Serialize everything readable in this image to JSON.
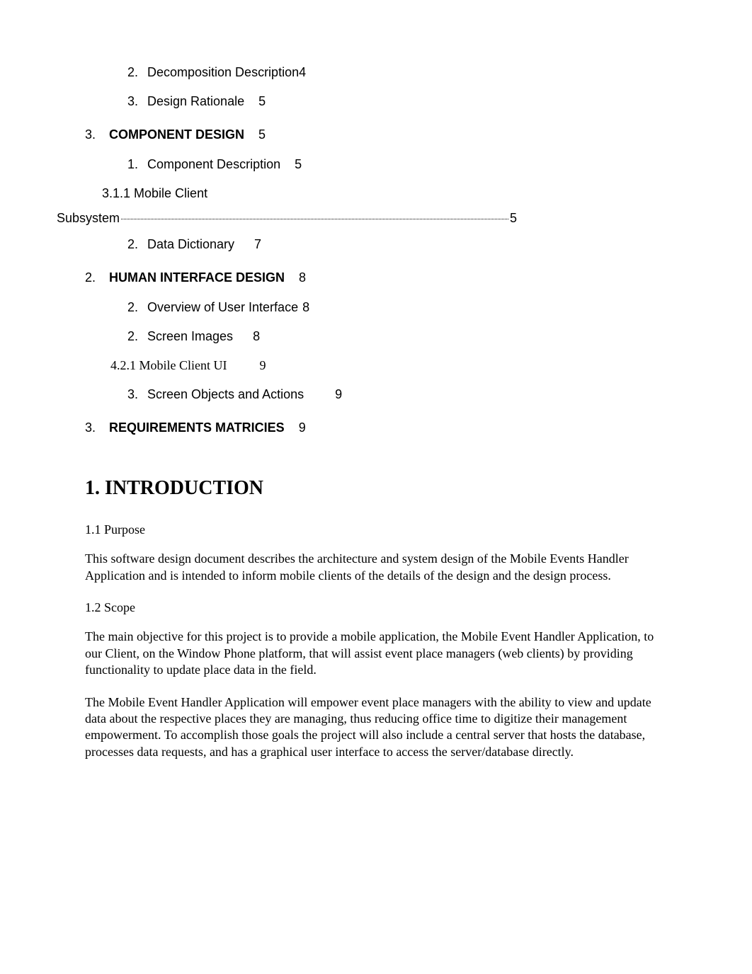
{
  "toc": {
    "items": [
      {
        "num": "2.",
        "label": "Decomposition Description",
        "page": "4",
        "indent": "1",
        "bold": false,
        "serif": false,
        "pagePad": "tight"
      },
      {
        "num": "3.",
        "label": "Design Rationale",
        "page": "5",
        "indent": "1",
        "bold": false,
        "serif": false,
        "pagePad": "norm"
      },
      {
        "num": "3.",
        "label": "COMPONENT DESIGN",
        "page": "5",
        "indent": "0",
        "bold": true,
        "serif": false,
        "pagePad": "norm"
      },
      {
        "num": "1.",
        "label": "Component Description",
        "page": "5",
        "indent": "1",
        "bold": false,
        "serif": false,
        "pagePad": "norm"
      }
    ],
    "dotted": {
      "line1": "3.1.1 Mobile Client",
      "line2_label": "Subsystem",
      "page": "5"
    },
    "items2": [
      {
        "num": "2.",
        "label": "Data Dictionary",
        "page": "7",
        "indent": "1",
        "bold": false,
        "serif": false,
        "pagePad": "wide"
      },
      {
        "num": "2.",
        "label": "HUMAN INTERFACE DESIGN",
        "page": "8",
        "indent": "0",
        "bold": true,
        "serif": false,
        "pagePad": "norm"
      },
      {
        "num": "2.",
        "label": "Overview of User Interface",
        "page": "8",
        "indent": "1",
        "bold": false,
        "serif": false,
        "pagePad": "tight2"
      },
      {
        "num": "2.",
        "label": "Screen Images",
        "page": "8",
        "indent": "1",
        "bold": false,
        "serif": false,
        "pagePad": "wide"
      },
      {
        "num": "",
        "label": "4.2.1 Mobile Client UI",
        "page": "9",
        "indent": "3",
        "bold": false,
        "serif": true,
        "pagePad": "wide2"
      },
      {
        "num": "3.",
        "label": "Screen Objects and Actions",
        "page": "9",
        "indent": "1",
        "bold": false,
        "serif": false,
        "pagePad": "vwide"
      },
      {
        "num": "3.",
        "label": "REQUIREMENTS MATRICIES",
        "page": "9",
        "indent": "0",
        "bold": true,
        "serif": false,
        "pagePad": "norm"
      }
    ]
  },
  "body": {
    "h1": "1. INTRODUCTION",
    "sec1": {
      "head": "1.1 Purpose",
      "para": "This software design document describes the architecture and system design of the Mobile Events Handler Application and is intended to inform mobile clients of the details of the design and the design process."
    },
    "sec2": {
      "head": "1.2 Scope",
      "para1": "The main objective for this project is to provide a mobile application, the Mobile Event Handler Application, to our Client, on the Window Phone platform, that will assist event place managers (web clients) by providing functionality to update place data in the field.",
      "para2": "The Mobile Event Handler Application will empower event place managers with the ability to view and update data about the respective places they are managing, thus reducing office time to digitize their management empowerment. To accomplish those goals the project will also include a central server that hosts the database, processes data requests, and has a graphical user interface to access the server/database directly."
    }
  }
}
